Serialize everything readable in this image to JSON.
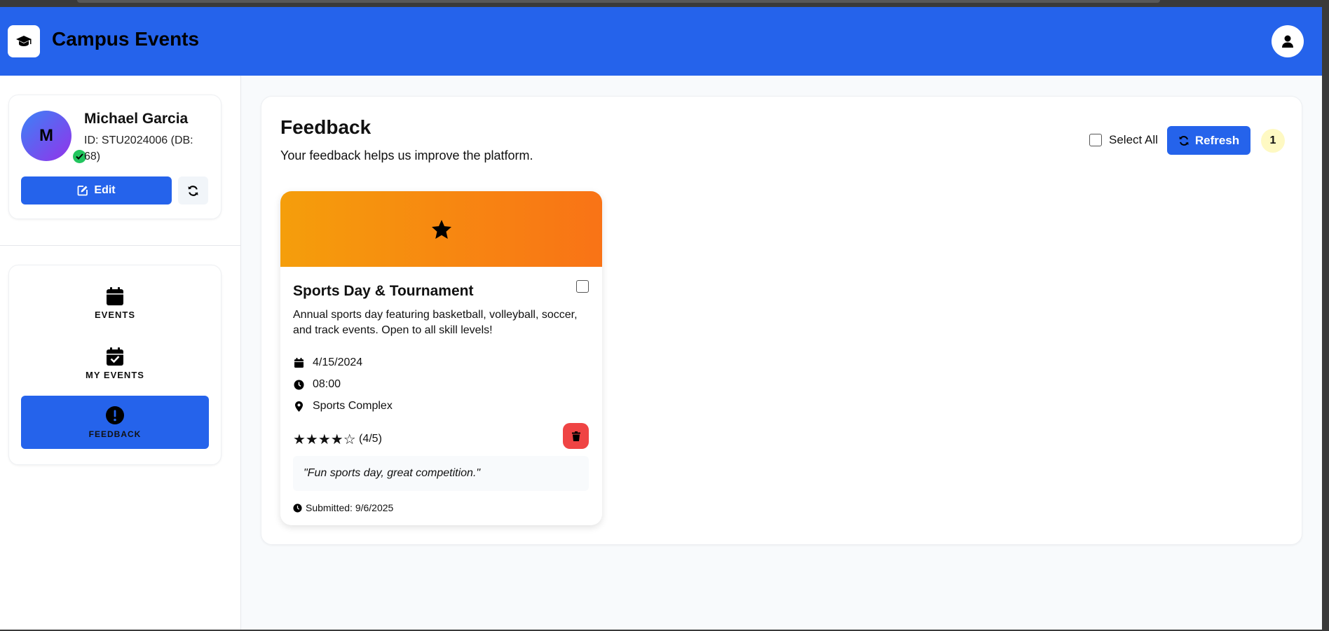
{
  "header": {
    "app_title": "Campus Events",
    "logo_icon": "graduation-cap-icon",
    "user_icon": "user-icon",
    "brand_color": "#2563eb"
  },
  "profile": {
    "avatar_initial": "M",
    "name": "Michael Garcia",
    "id_line": "ID: STU2024006 (DB: 68)",
    "edit_label": "Edit",
    "verified_icon": "check-circle-icon"
  },
  "nav": {
    "items": [
      {
        "label": "EVENTS",
        "icon": "calendar-icon",
        "active": false
      },
      {
        "label": "MY EVENTS",
        "icon": "calendar-check-icon",
        "active": false
      },
      {
        "label": "FEEDBACK",
        "icon": "exclamation-circle-icon",
        "active": true
      }
    ]
  },
  "main": {
    "title": "Feedback",
    "subtitle": "Your feedback helps us improve the platform.",
    "select_all_label": "Select All",
    "refresh_label": "Refresh",
    "count": "1"
  },
  "feedback_card": {
    "banner_icon": "star-icon",
    "title": "Sports Day & Tournament",
    "description": "Annual sports day featuring basketball, volleyball, soccer, and track events. Open to all skill levels!",
    "date": "4/15/2024",
    "time": "08:00",
    "location": "Sports Complex",
    "stars": "★★★★☆",
    "rating": 4,
    "rating_max": 5,
    "rating_text": "(4/5)",
    "comment": "\"Fun sports day, great competition.\"",
    "submitted": "Submitted: 9/6/2025",
    "banner_colors": [
      "#f59e0b",
      "#f97316"
    ],
    "delete_color": "#ef4444"
  }
}
